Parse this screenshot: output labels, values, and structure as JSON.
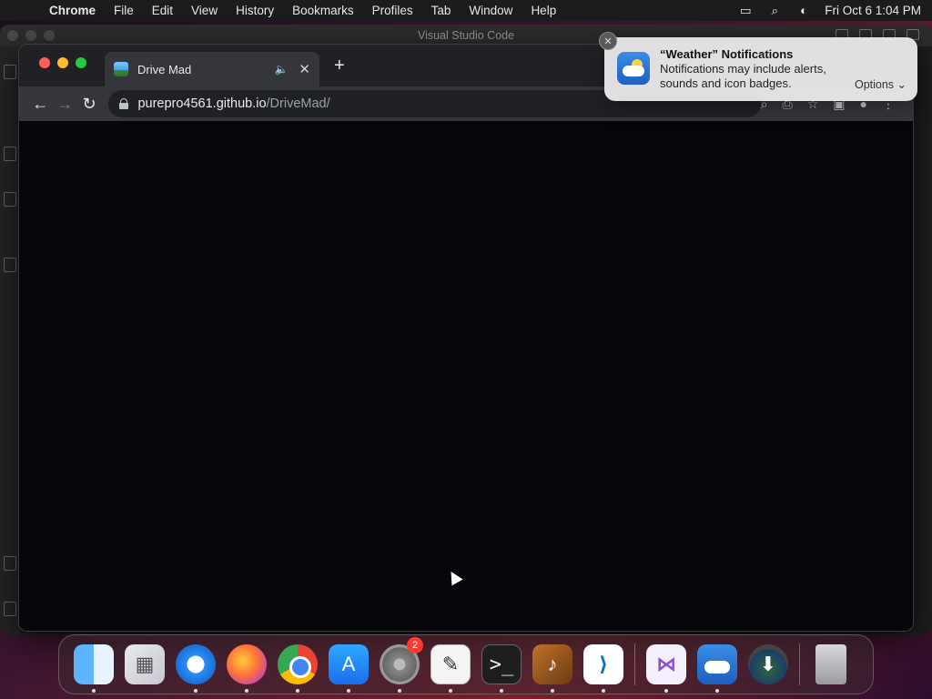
{
  "menubar": {
    "app_name": "Chrome",
    "items": [
      "File",
      "Edit",
      "View",
      "History",
      "Bookmarks",
      "Profiles",
      "Tab",
      "Window",
      "Help"
    ],
    "clock": "Fri Oct 6  1:04 PM"
  },
  "background_window": {
    "title": "Visual Studio Code"
  },
  "browser": {
    "tab_title": "Drive Mad",
    "new_tab_symbol": "+",
    "url_host": "purepro4561.github.io",
    "url_path": "/DriveMad/"
  },
  "notification": {
    "title": "“Weather” Notifications",
    "body": "Notifications may include alerts, sounds and icon badges.",
    "options_label": "Options ⌄"
  },
  "dock": {
    "apps": [
      {
        "name": "finder",
        "glyph": ""
      },
      {
        "name": "launchpad",
        "glyph": "▦"
      },
      {
        "name": "safari",
        "glyph": ""
      },
      {
        "name": "firefox",
        "glyph": ""
      },
      {
        "name": "chrome",
        "glyph": ""
      },
      {
        "name": "app-store",
        "glyph": "A"
      },
      {
        "name": "system-settings",
        "glyph": "⚙",
        "badge": "2"
      },
      {
        "name": "textedit",
        "glyph": "✎"
      },
      {
        "name": "terminal",
        "glyph": ">_"
      },
      {
        "name": "garageband",
        "glyph": "♪"
      },
      {
        "name": "vscode",
        "glyph": "⟩"
      }
    ],
    "apps_right": [
      {
        "name": "visual-studio",
        "glyph": "⋈"
      },
      {
        "name": "weather",
        "glyph": ""
      },
      {
        "name": "installer",
        "glyph": "⬇"
      },
      {
        "name": "trash",
        "glyph": ""
      }
    ]
  }
}
